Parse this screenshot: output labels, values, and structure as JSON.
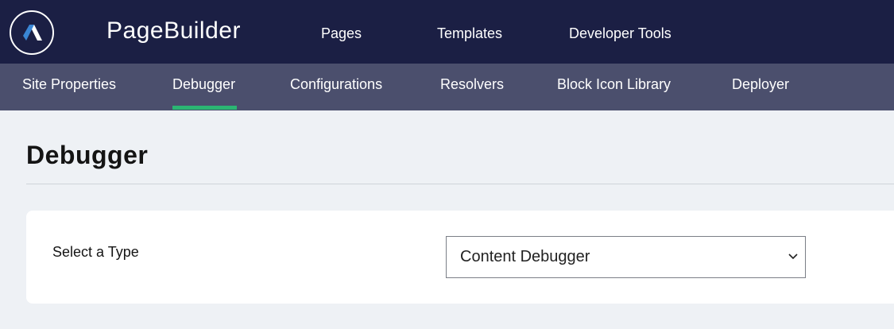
{
  "header": {
    "app_title": "PageBuilder",
    "nav": [
      "Pages",
      "Templates",
      "Developer Tools"
    ]
  },
  "subnav": {
    "items": [
      "Site Properties",
      "Debugger",
      "Configurations",
      "Resolvers",
      "Block Icon Library",
      "Deployer"
    ],
    "active": "Debugger"
  },
  "main": {
    "page_title": "Debugger",
    "type_label": "Select a Type",
    "type_select_value": "Content Debugger"
  },
  "colors": {
    "topbar": "#1b1f44",
    "subbar": "#4b4f6d",
    "accent": "#2bb673",
    "background": "#eef1f5"
  },
  "icons": {
    "logo": "arc-logo-icon",
    "select_caret": "chevron-down-icon"
  }
}
